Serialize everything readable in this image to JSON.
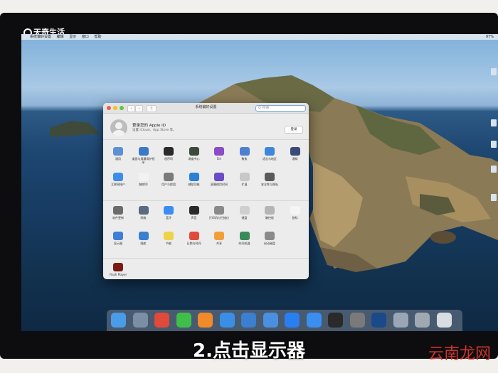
{
  "brand": {
    "name": "天奇生活"
  },
  "caption": "2.点击显示器",
  "watermark": "云南龙网",
  "menubar": {
    "items": [
      "系统偏好设置",
      "编辑",
      "显示",
      "窗口",
      "帮助"
    ],
    "status": "97%"
  },
  "window": {
    "title": "系统偏好设置",
    "search_placeholder": "Q 搜索",
    "account": {
      "title": "登录您的 Apple ID",
      "subtitle": "设置 iCloud、App Store 等。",
      "login_label": "登录"
    },
    "rows": [
      [
        {
          "label": "通用",
          "color": "#5b8fd6"
        },
        {
          "label": "桌面与屏幕保护程序",
          "color": "#3a79c8"
        },
        {
          "label": "程序坞",
          "color": "#2a2a2a"
        },
        {
          "label": "调度中心",
          "color": "#3b4a3c"
        },
        {
          "label": "Siri",
          "color": "#8a4cc8"
        },
        {
          "label": "聚焦",
          "color": "#4f7fd2"
        },
        {
          "label": "语言与地区",
          "color": "#3d86d8"
        },
        {
          "label": "通知",
          "color": "#3a4b7a"
        }
      ],
      [
        {
          "label": "互联网帐户",
          "color": "#3c8ee6"
        },
        {
          "label": "触控ID",
          "color": "#f2f2f2"
        },
        {
          "label": "用户与群组",
          "color": "#7a7a7a"
        },
        {
          "label": "辅助功能",
          "color": "#2a7fd8"
        },
        {
          "label": "屏幕使用时间",
          "color": "#6b4bc8"
        },
        {
          "label": "扩展",
          "color": "#c8c8c8"
        },
        {
          "label": "安全性与隐私",
          "color": "#5a5a5a"
        }
      ],
      [
        {
          "label": "软件更新",
          "color": "#6b6b6b"
        },
        {
          "label": "网络",
          "color": "#5a6a80"
        },
        {
          "label": "蓝牙",
          "color": "#3b8ef0"
        },
        {
          "label": "声音",
          "color": "#2a2a2a"
        },
        {
          "label": "打印机与扫描仪",
          "color": "#8a8a8a"
        },
        {
          "label": "键盘",
          "color": "#cfcfcf"
        },
        {
          "label": "触控板",
          "color": "#b5b5b5"
        },
        {
          "label": "鼠标",
          "color": "#f5f5f5"
        }
      ],
      [
        {
          "label": "显示器",
          "color": "#3f7ed8"
        },
        {
          "label": "随航",
          "color": "#3a7fd0"
        },
        {
          "label": "节能",
          "color": "#f0d24a"
        },
        {
          "label": "日期与时间",
          "color": "#e04b3c"
        },
        {
          "label": "共享",
          "color": "#f0a03a"
        },
        {
          "label": "时间机器",
          "color": "#3a8a5a"
        },
        {
          "label": "启动磁盘",
          "color": "#8a8a8a"
        }
      ]
    ],
    "other": [
      {
        "label": "Flash Player",
        "color": "#7a1a12"
      }
    ]
  },
  "dock": {
    "apps": [
      {
        "name": "Finder",
        "color": "#4a9be8"
      },
      {
        "name": "Launchpad",
        "color": "#7a8fa5"
      },
      {
        "name": "Gaming",
        "color": "#e04a3a"
      },
      {
        "name": "WeChat",
        "color": "#3fbf4a"
      },
      {
        "name": "Firefox",
        "color": "#f08a2a"
      },
      {
        "name": "Safari",
        "color": "#3a8ee6"
      },
      {
        "name": "Xcode",
        "color": "#3a7fd0"
      },
      {
        "name": "Files",
        "color": "#4a8fe0"
      },
      {
        "name": "App Store",
        "color": "#2a7ff0"
      },
      {
        "name": "Update",
        "color": "#3a8ef0"
      },
      {
        "name": "Terminal",
        "color": "#2a2a2a"
      },
      {
        "name": "System Preferences",
        "color": "#7a7a7a"
      },
      {
        "name": "QuickTime",
        "color": "#1a4a8a"
      },
      {
        "name": "Utility",
        "color": "#9aa5b5"
      },
      {
        "name": "Preview",
        "color": "#a0a8b2"
      },
      {
        "name": "Trash",
        "color": "#d8dde2"
      }
    ]
  }
}
